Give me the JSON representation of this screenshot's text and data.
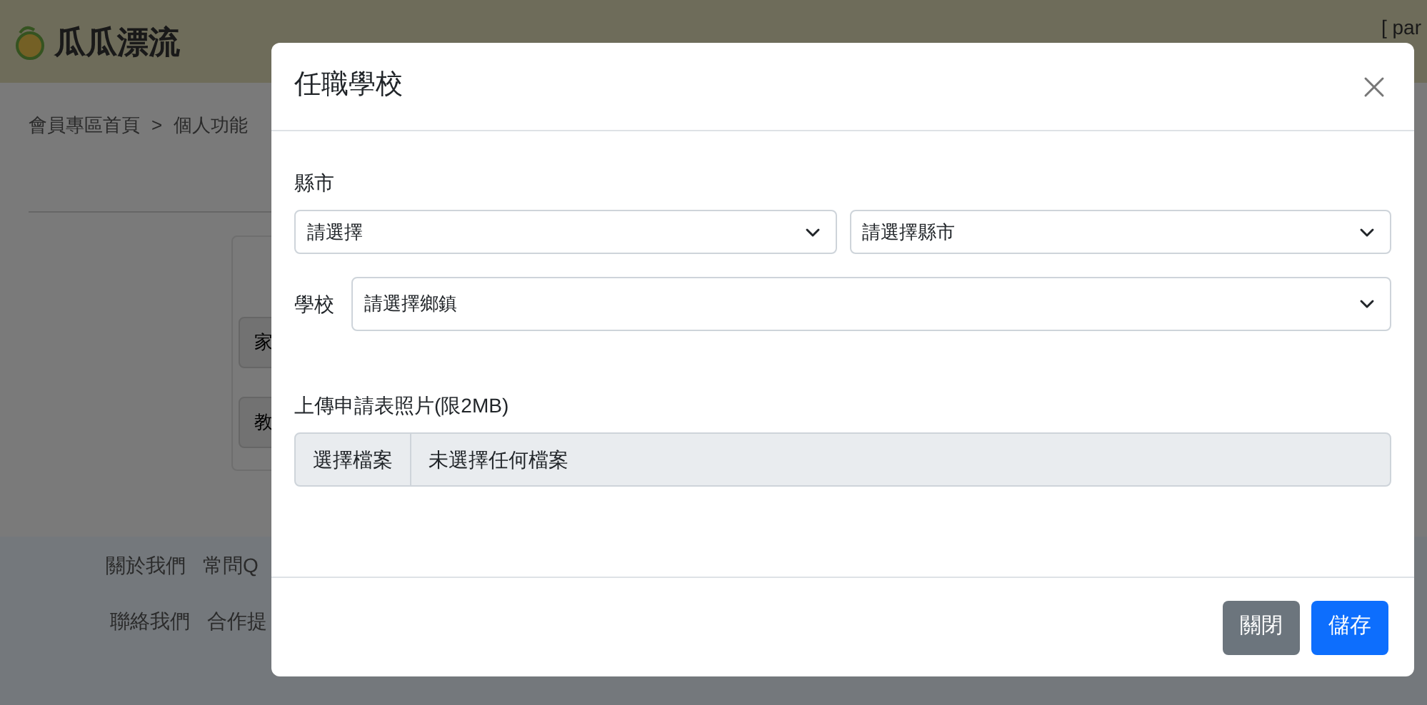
{
  "nav": {
    "logo": "瓜瓜漂流",
    "user": "[ par"
  },
  "breadcrumb": [
    "會員專區首頁",
    ">",
    "個人功能"
  ],
  "side_buttons": [
    "家",
    "教"
  ],
  "footer": {
    "rows": [
      [
        "關於我們",
        "常問Q"
      ],
      [
        "聯絡我們",
        "合作提"
      ]
    ]
  },
  "modal": {
    "title": "任職學校",
    "city": {
      "label": "縣市",
      "selects": [
        {
          "value": "請選擇"
        },
        {
          "value": "請選擇縣市"
        }
      ]
    },
    "school": {
      "label": "學校",
      "value": "請選擇鄉鎮"
    },
    "upload": {
      "label": "上傳申請表照片(限2MB)",
      "button": "選擇檔案",
      "status": "未選擇任何檔案"
    },
    "buttons": [
      {
        "label": "關閉",
        "kind": "secondary"
      },
      {
        "label": "儲存",
        "kind": "primary"
      }
    ]
  }
}
